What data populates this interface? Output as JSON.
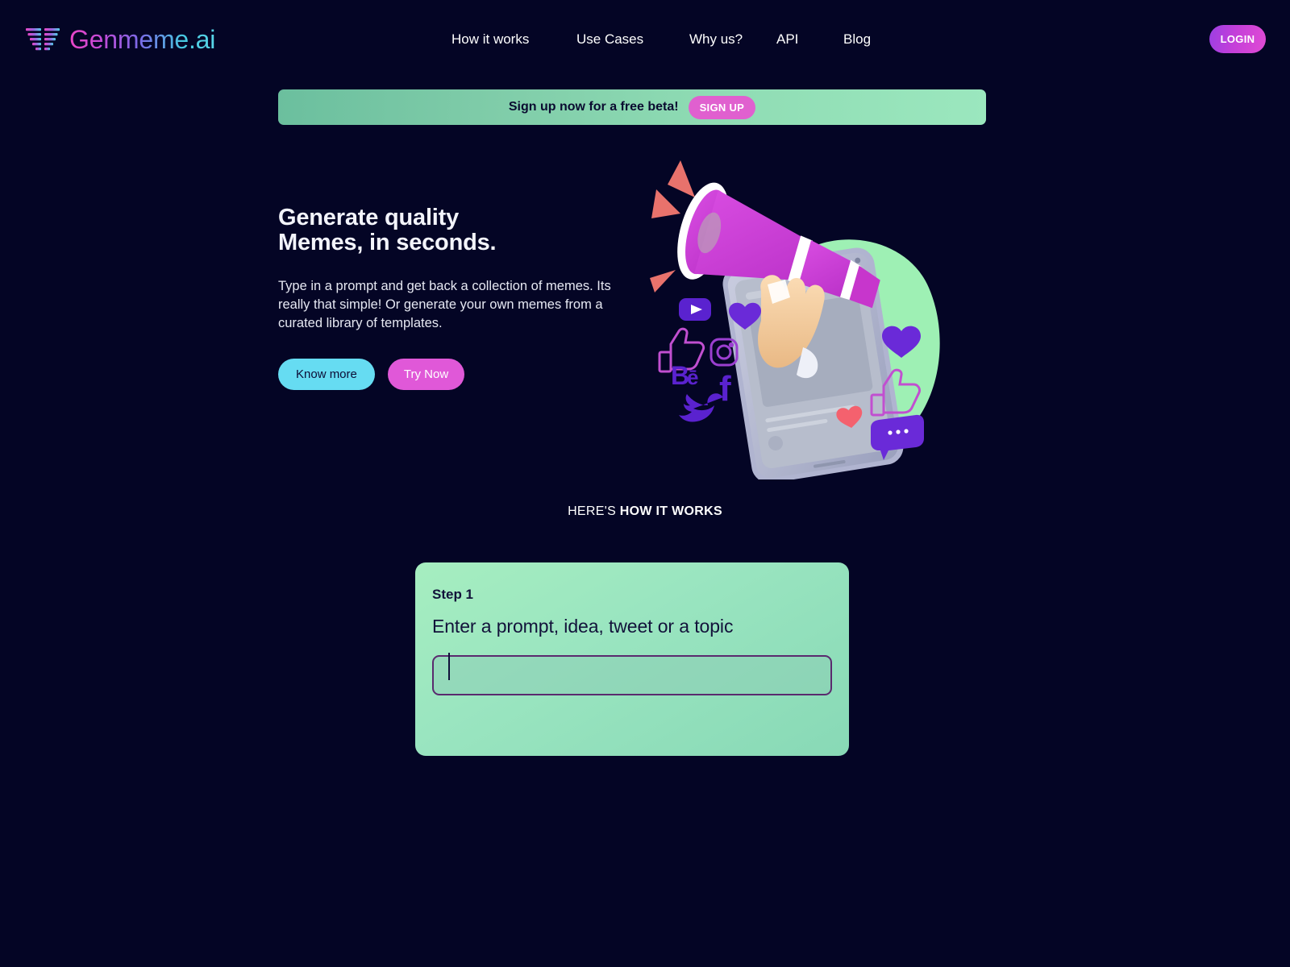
{
  "brand": {
    "name": "Genmeme.ai",
    "logo_icon": "genmeme-triangle-logo",
    "gradient_start": "#e946c6",
    "gradient_end": "#59d6e8"
  },
  "nav": {
    "items": [
      {
        "label": "How it works"
      },
      {
        "label": "Use Cases"
      },
      {
        "label": "Why us?"
      },
      {
        "label": "API"
      },
      {
        "label": "Blog"
      }
    ],
    "login_label": "LOGIN"
  },
  "banner": {
    "text": "Sign up now for a free beta!",
    "button_label": "SIGN UP",
    "background_start": "#6bbf9e",
    "background_end": "#9be7be",
    "button_color": "#e060cf"
  },
  "hero": {
    "title_line_1": "Generate quality",
    "title_line_2": "Memes, in seconds.",
    "subtitle": "Type in a prompt and get back a collection of memes. Its really that simple! Or generate your own memes from a curated library of templates.",
    "primary_button": "Know more",
    "secondary_button": "Try Now",
    "primary_button_color": "#66dcf2",
    "secondary_button_color": "#e058d8",
    "illustration": {
      "name": "megaphone-hand-phone-illustration",
      "blob_color": "#9ef0b4",
      "megaphone_color": "#cc3fd1",
      "soundwave_color": "#e8726c",
      "social_icons": [
        "youtube-icon",
        "thumbs-up-outline-icon",
        "instagram-icon",
        "behance-icon",
        "facebook-icon",
        "twitter-icon",
        "heart-icon",
        "thumbs-up-icon",
        "chat-bubble-icon",
        "heart-small-icon"
      ]
    }
  },
  "how_it_works": {
    "label_light": "HERE'S ",
    "label_bold": "HOW IT WORKS"
  },
  "step": {
    "number_label": "Step 1",
    "title": "Enter a prompt, idea, tweet or a topic",
    "input_value": "",
    "input_placeholder": "",
    "card_color": "#9ae5c0",
    "input_border_color": "#5a2a6e"
  }
}
